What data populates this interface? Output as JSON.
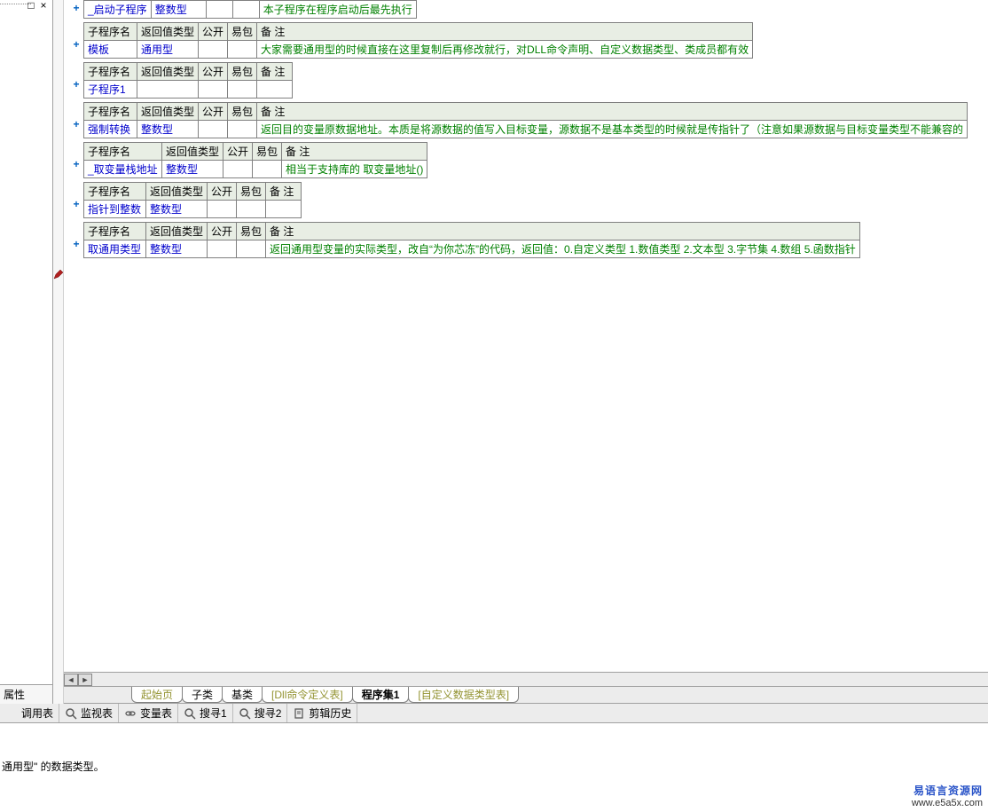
{
  "headers": {
    "name": "子程序名",
    "ret": "返回值类型",
    "pub": "公开",
    "pkg": "易包",
    "note": "备 注"
  },
  "rows": [
    {
      "name": "_启动子程序",
      "ret": "整数型",
      "note": "本子程序在程序启动后最先执行",
      "nameW": 60,
      "retW": 62,
      "single": true
    },
    {
      "name": "模板",
      "ret": "通用型",
      "note": "大家需要通用型的时候直接在这里复制后再修改就行，对DLL命令声明、自定义数据类型、类成员都有效",
      "nameW": 60,
      "retW": 62
    },
    {
      "name": "子程序1",
      "ret": "",
      "note": "",
      "nameW": 60,
      "retW": 62
    },
    {
      "name": "强制转换",
      "ret": "整数型",
      "note": "返回目的变量原数据地址。本质是将源数据的值写入目标变量，源数据不是基本类型的时候就是传指针了（注意如果源数据与目标变量类型不能兼容的",
      "nameW": 60,
      "retW": 62
    },
    {
      "name": "_取变量栈地址",
      "ret": "整数型",
      "note": "相当于支持库的 取变量地址()",
      "nameW": 88,
      "retW": 62
    },
    {
      "name": "指针到整数",
      "ret": "整数型",
      "note": "",
      "nameW": 70,
      "retW": 62
    },
    {
      "name": "取通用类型",
      "ret": "整数型",
      "note": "返回通用型变量的实际类型，改自“为你芯冻”的代码，返回值：0.自定义类型  1.数值类型  2.文本型  3.字节集  4.数组  5.函数指针",
      "nameW": 70,
      "retW": 62,
      "pen": true
    }
  ],
  "docTabs": [
    {
      "label": "起始页",
      "dim": true
    },
    {
      "label": "子类"
    },
    {
      "label": "基类"
    },
    {
      "label": "[Dll命令定义表]",
      "dim": true
    },
    {
      "label": "程序集1",
      "active": true
    },
    {
      "label": "[自定义数据类型表]",
      "dim": true
    }
  ],
  "toolTabs": [
    {
      "label": "调用表",
      "icon": "call"
    },
    {
      "label": "监视表",
      "icon": "magnifier"
    },
    {
      "label": "变量表",
      "icon": "link"
    },
    {
      "label": "搜寻1",
      "icon": "search"
    },
    {
      "label": "搜寻2",
      "icon": "search"
    },
    {
      "label": "剪辑历史",
      "icon": "clip"
    }
  ],
  "propTab": "属性",
  "message": "通用型\" 的数据类型。",
  "watermark": {
    "line1": "易语言资源网",
    "line2": "www.e5a5x.com"
  },
  "plus": "+",
  "treeControls": {
    "maximize": "□",
    "close": "×"
  }
}
